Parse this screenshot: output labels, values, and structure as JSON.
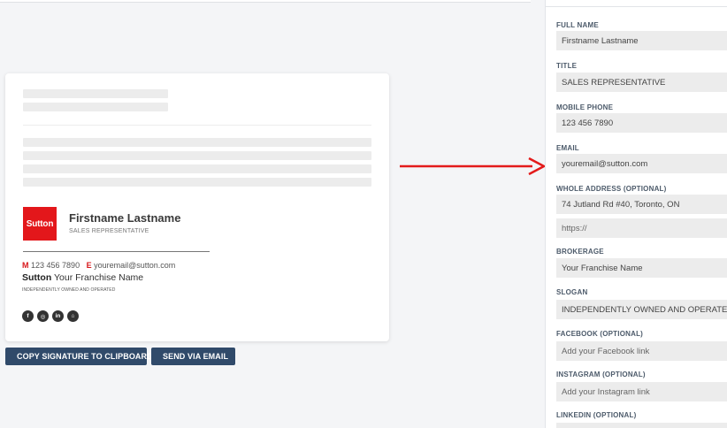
{
  "preview": {
    "logo_text": "Sutton",
    "name": "Firstname Lastname",
    "title": "SALES REPRESENTATIVE",
    "mobile_prefix": "M",
    "mobile": "123 456 7890",
    "email_prefix": "E",
    "email": "youremail@sutton.com",
    "company_brand": "Sutton",
    "company_name": "Your Franchise Name",
    "slogan": "INDEPENDENTLY OWNED AND OPERATED",
    "social_icons": [
      {
        "name": "facebook-icon",
        "glyph": "f"
      },
      {
        "name": "instagram-icon",
        "glyph": "◎"
      },
      {
        "name": "linkedin-icon",
        "glyph": "in"
      },
      {
        "name": "house-icon",
        "glyph": "⌂"
      }
    ]
  },
  "buttons": {
    "copy_label": "COPY SIGNATURE TO CLIPBOARD",
    "send_label": "SEND VIA EMAIL"
  },
  "form": {
    "full_name": {
      "label": "FULL NAME",
      "value": "Firstname Lastname"
    },
    "title": {
      "label": "TITLE",
      "value": "SALES REPRESENTATIVE"
    },
    "mobile_phone": {
      "label": "MOBILE PHONE",
      "value": "123 456 7890"
    },
    "email": {
      "label": "EMAIL",
      "value": "youremail@sutton.com"
    },
    "address": {
      "label": "WHOLE ADDRESS (OPTIONAL)",
      "value": "74 Jutland Rd #40, Toronto, ON"
    },
    "website": {
      "placeholder": "https://"
    },
    "brokerage": {
      "label": "BROKERAGE",
      "value": "Your Franchise Name"
    },
    "slogan": {
      "label": "SLOGAN",
      "value": "INDEPENDENTLY OWNED AND OPERATED"
    },
    "facebook": {
      "label": "FACEBOOK (OPTIONAL)",
      "placeholder": "Add your Facebook link"
    },
    "instagram": {
      "label": "INSTAGRAM (OPTIONAL)",
      "placeholder": "Add your Instagram link"
    },
    "linkedin": {
      "label": "LINKEDIN (OPTIONAL)"
    }
  },
  "colors": {
    "brand_red": "#e3171b",
    "button_navy": "#304a6a",
    "arrow_red": "#e31b1b"
  }
}
